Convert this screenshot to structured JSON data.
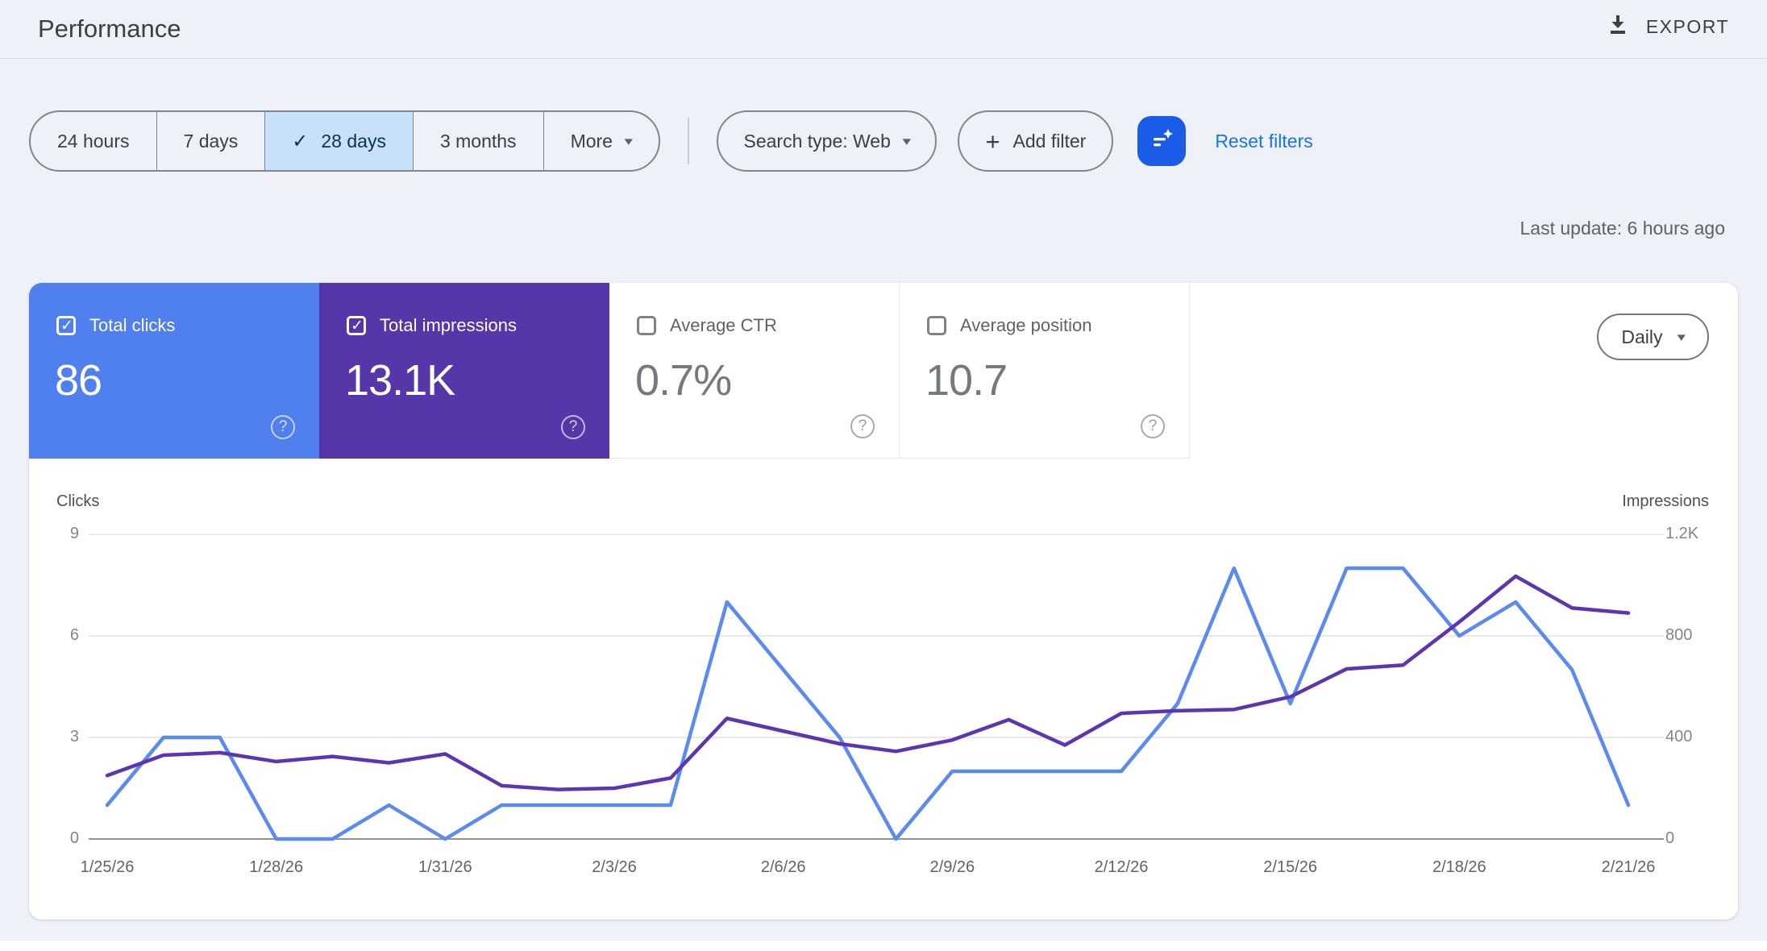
{
  "header": {
    "title": "Performance",
    "export_label": "EXPORT"
  },
  "filters": {
    "date_ranges": [
      {
        "label": "24 hours",
        "selected": false
      },
      {
        "label": "7 days",
        "selected": false
      },
      {
        "label": "28 days",
        "selected": true
      },
      {
        "label": "3 months",
        "selected": false
      }
    ],
    "more_label": "More",
    "search_type_label": "Search type: Web",
    "add_filter_label": "Add filter",
    "reset_label": "Reset filters",
    "accent_blue": "#1a73e8",
    "filter_button_bg": "#1a5ce8",
    "selected_chip_bg": "#c8e0f9"
  },
  "status": {
    "last_update": "Last update: 6 hours ago"
  },
  "metrics": {
    "granularity": "Daily",
    "cards": [
      {
        "label": "Total clicks",
        "value": "86",
        "checked": true,
        "color": "#4f80ee"
      },
      {
        "label": "Total impressions",
        "value": "13.1K",
        "checked": true,
        "color": "#5636a8"
      },
      {
        "label": "Average CTR",
        "value": "0.7%",
        "checked": false,
        "color": "#ffffff"
      },
      {
        "label": "Average position",
        "value": "10.7",
        "checked": false,
        "color": "#ffffff"
      }
    ]
  },
  "chart_data": {
    "type": "line",
    "x": [
      "1/25/26",
      "1/26/26",
      "1/27/26",
      "1/28/26",
      "1/29/26",
      "1/30/26",
      "1/31/26",
      "2/1/26",
      "2/2/26",
      "2/3/26",
      "2/4/26",
      "2/5/26",
      "2/6/26",
      "2/7/26",
      "2/8/26",
      "2/9/26",
      "2/10/26",
      "2/11/26",
      "2/12/26",
      "2/13/26",
      "2/14/26",
      "2/15/26",
      "2/16/26",
      "2/17/26",
      "2/18/26",
      "2/19/26",
      "2/20/26",
      "2/21/26"
    ],
    "x_tick_labels": [
      "1/25/26",
      "1/28/26",
      "1/31/26",
      "2/3/26",
      "2/6/26",
      "2/9/26",
      "2/12/26",
      "2/15/26",
      "2/18/26",
      "2/21/26"
    ],
    "series": [
      {
        "name": "Clicks",
        "axis": "left",
        "color": "#5b8bf0",
        "values": [
          1,
          3,
          3,
          0,
          0,
          1,
          0,
          1,
          1,
          1,
          1,
          7,
          5,
          3,
          0,
          2,
          2,
          2,
          2,
          4,
          8,
          4,
          8,
          8,
          6,
          7,
          5,
          1
        ]
      },
      {
        "name": "Impressions",
        "axis": "right",
        "color": "#5e35b1",
        "values": [
          250,
          330,
          340,
          305,
          325,
          300,
          335,
          210,
          195,
          200,
          240,
          475,
          425,
          375,
          345,
          390,
          470,
          370,
          495,
          505,
          510,
          560,
          670,
          685,
          855,
          1035,
          910,
          890
        ]
      }
    ],
    "left_axis": {
      "title": "Clicks",
      "ticks": [
        0,
        3,
        6,
        9
      ],
      "tick_labels": [
        "0",
        "3",
        "6",
        "9"
      ],
      "max": 9
    },
    "right_axis": {
      "title": "Impressions",
      "ticks": [
        0,
        400,
        800,
        1200
      ],
      "tick_labels": [
        "0",
        "400",
        "800",
        "1.2K"
      ],
      "max": 1200
    },
    "grid": true,
    "legend_position": "none"
  }
}
